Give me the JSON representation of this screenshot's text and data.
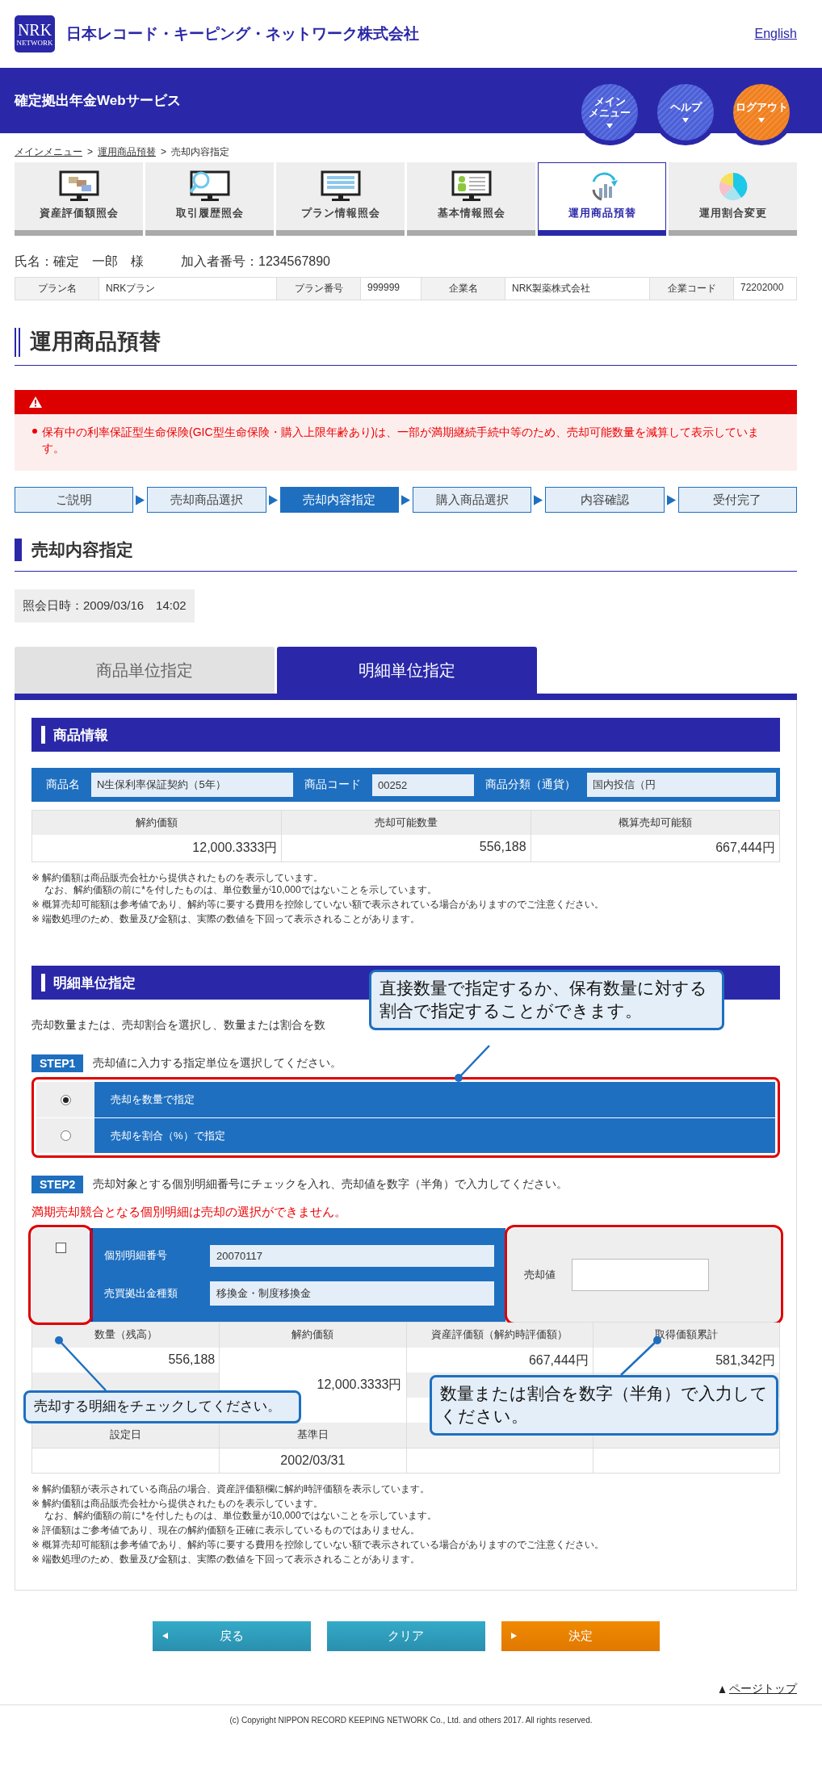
{
  "header": {
    "logo": {
      "letters": "NRK",
      "sub": "NETWORK"
    },
    "company": "日本レコード・キーピング・ネットワーク株式会社",
    "language_link": "English"
  },
  "service_bar": {
    "title": "確定拠出年金Webサービス",
    "round_buttons": [
      {
        "lines": [
          "メイン",
          "メニュー"
        ],
        "color": "#4a5fd8"
      },
      {
        "lines": [
          "ヘルプ"
        ],
        "color": "#4a5fd8"
      },
      {
        "lines": [
          "ログアウト"
        ],
        "color": "#f07f1e"
      }
    ]
  },
  "breadcrumbs": {
    "items": [
      {
        "label": "メインメニュー",
        "link": true
      },
      {
        "label": "運用商品預替",
        "link": true
      },
      {
        "label": "売却内容指定",
        "link": false
      }
    ],
    "separators": [
      ">",
      ">"
    ]
  },
  "nav_tiles": [
    {
      "label": "資産評価額照会",
      "kind": "assets",
      "selected": false
    },
    {
      "label": "取引履歴照会",
      "kind": "history",
      "selected": false
    },
    {
      "label": "プラン情報照会",
      "kind": "plan",
      "selected": false
    },
    {
      "label": "基本情報照会",
      "kind": "profile",
      "selected": false
    },
    {
      "label": "運用商品預替",
      "kind": "switch",
      "selected": true
    },
    {
      "label": "運用割合変更",
      "kind": "ratio",
      "selected": false
    }
  ],
  "member": {
    "name": "氏名：確定　一郎　様",
    "number": "加入者番号：1234567890"
  },
  "plan_info": [
    {
      "label": "プラン名",
      "value": "NRKプラン"
    },
    {
      "label": "プラン番号",
      "value": "999999"
    },
    {
      "label": "企業名",
      "value": "NRK製薬株式会社"
    },
    {
      "label": "企業コード",
      "value": "72202000"
    }
  ],
  "page_title": "運用商品預替",
  "alert": {
    "messages": [
      "保有中の利率保証型生命保険(GIC型生命保険・購入上限年齢あり)は、一部が満期継続手続中等のため、売却可能数量を減算して表示しています。"
    ]
  },
  "steps": [
    {
      "label": "ご説明",
      "selected": false
    },
    {
      "label": "売却商品選択",
      "selected": false
    },
    {
      "label": "売却内容指定",
      "selected": true
    },
    {
      "label": "購入商品選択",
      "selected": false
    },
    {
      "label": "内容確認",
      "selected": false
    },
    {
      "label": "受付完了",
      "selected": false
    }
  ],
  "section_title": "売却内容指定",
  "query_time": "照会日時：2009/03/16　14:02",
  "tabs": [
    {
      "label": "商品単位指定",
      "selected": false
    },
    {
      "label": "明細単位指定",
      "selected": true
    }
  ],
  "product_info": {
    "title": "商品情報",
    "fields": [
      {
        "label": "商品名",
        "value": "N生保利率保証契約（5年）"
      },
      {
        "label": "商品コード",
        "value": "00252"
      },
      {
        "label": "商品分類（通貨）",
        "value": "国内投信（円"
      }
    ],
    "table": {
      "columns": [
        "解約価額",
        "売却可能数量",
        "概算売却可能額"
      ],
      "values": [
        "12,000.3333円",
        "556,188",
        "667,444円"
      ]
    },
    "notes": [
      {
        "lines": [
          "※ 解約価額は商品販売会社から提供されたものを表示しています。",
          "なお、解約価額の前に*を付したものは、単位数量が10,000ではないことを示しています。"
        ]
      },
      {
        "lines": [
          "※ 概算売却可能額は参考値であり、解約等に要する費用を控除していない額で表示されている場合がありますのでご注意ください。"
        ]
      },
      {
        "lines": [
          "※ 端数処理のため、数量及び金額は、実際の数値を下回って表示されることがあります。"
        ]
      }
    ]
  },
  "detail": {
    "title": "明細単位指定",
    "intro": "売却数量または、売却割合を選択し、数量または割合を数",
    "step1": {
      "badge": "STEP1",
      "text": "売却値に入力する指定単位を選択してください。"
    },
    "unit_options": [
      {
        "label": "売却を数量で指定",
        "selected": true
      },
      {
        "label": "売却を割合（%）で指定",
        "selected": false
      }
    ],
    "step2": {
      "badge": "STEP2",
      "text": "売却対象とする個別明細番号にチェックを入れ、売却値を数字（半角）で入力してください。"
    },
    "warning": "満期売却競合となる個別明細は売却の選択ができません。",
    "item": {
      "checked": false,
      "fields": [
        {
          "label": "個別明細番号",
          "value": "20070117"
        },
        {
          "label": "売買拠出金種類",
          "value": "移換金・制度移換金"
        }
      ],
      "sale_label": "売却値"
    },
    "table": {
      "top_headers": [
        "数量（残高）",
        "解約価額",
        "資産評価額（解約時評価額）",
        "取得価額累計"
      ],
      "top_values": [
        "556,188",
        "667,444円",
        "581,342円"
      ],
      "contract_value": "12,000.3333円",
      "bottom_headers": [
        "設定日",
        "基準日"
      ],
      "bottom_values": [
        "2002/03/31"
      ]
    },
    "notes": [
      {
        "lines": [
          "※ 解約価額が表示されている商品の場合、資産評価額欄に解約時評価額を表示しています。"
        ]
      },
      {
        "lines": [
          "※ 解約価額は商品販売会社から提供されたものを表示しています。",
          "なお、解約価額の前に*を付したものは、単位数量が10,000ではないことを示しています。"
        ]
      },
      {
        "lines": [
          "※ 評価額はご参考値であり、現在の解約価額を正確に表示しているものではありません。"
        ]
      },
      {
        "lines": [
          "※ 概算売却可能額は参考値であり、解約等に要する費用を控除していない額で表示されている場合がありますのでご注意ください。"
        ]
      },
      {
        "lines": [
          "※ 端数処理のため、数量及び金額は、実際の数値を下回って表示されることがあります。"
        ]
      }
    ]
  },
  "callouts": [
    {
      "text": "直接数量で指定するか、保有数量に対する割合で指定することができます。"
    },
    {
      "text": "売却する明細をチェックしてください。"
    },
    {
      "text": "数量または割合を数字（半角）で入力してください。"
    }
  ],
  "buttons": [
    {
      "label": "戻る",
      "kind": "back"
    },
    {
      "label": "クリア",
      "kind": "clear"
    },
    {
      "label": "決定",
      "kind": "submit"
    }
  ],
  "page_top": "ページトップ",
  "copyright": "(c) Copyright NIPPON RECORD KEEPING NETWORK Co., Ltd. and others 2017. All rights reserved."
}
